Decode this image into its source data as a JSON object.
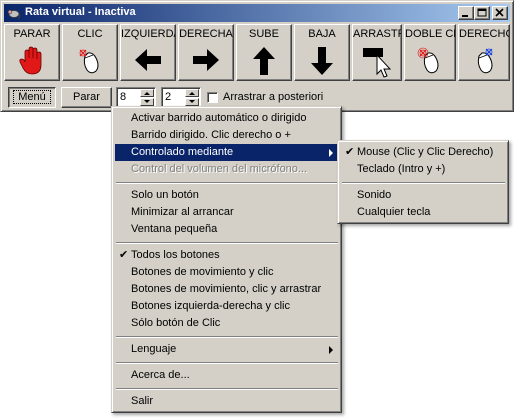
{
  "window": {
    "title": "Rata virtual - Inactiva",
    "controls": [
      "minimize-icon",
      "maximize-icon",
      "close-icon"
    ]
  },
  "toolbar": {
    "buttons": [
      {
        "label": "PARAR",
        "icon": "stop-hand-icon"
      },
      {
        "label": "CLIC",
        "icon": "mouse-click-icon"
      },
      {
        "label": "IZQUIERDA",
        "icon": "arrow-left-icon"
      },
      {
        "label": "DERECHA",
        "icon": "arrow-right-icon"
      },
      {
        "label": "SUBE",
        "icon": "arrow-up-icon"
      },
      {
        "label": "BAJA",
        "icon": "arrow-down-icon"
      },
      {
        "label": "ARRASTRAR",
        "icon": "drag-cursor-icon"
      },
      {
        "label": "DOBLE CLIC",
        "icon": "mouse-double-click-icon"
      },
      {
        "label": "DERECHO CLIC",
        "icon": "mouse-right-click-icon"
      }
    ]
  },
  "controls": {
    "menu_button": "Menú",
    "stop_button": "Parar",
    "speed_value": "8",
    "step_value": "2",
    "drag_later_label": "Arrastrar a posteriori",
    "drag_later_checked": false
  },
  "menu": {
    "items": [
      {
        "label": "Activar barrido automático o dirigido"
      },
      {
        "label": "Barrido dirigido. Clic derecho o +"
      },
      {
        "label": "Controlado mediante",
        "highlighted": true,
        "submenu": true
      },
      {
        "label": "Control del volumen del micrófono...",
        "disabled": true
      },
      {
        "label": "Solo un botón"
      },
      {
        "label": "Minimizar al arrancar"
      },
      {
        "label": "Ventana pequeña"
      },
      {
        "label": "Todos los botones",
        "checked": true
      },
      {
        "label": "Botones de movimiento y clic"
      },
      {
        "label": "Botones de movimiento, clic y arrastrar"
      },
      {
        "label": "Botones izquierda-derecha y clic"
      },
      {
        "label": "Sólo botón de Clic"
      },
      {
        "label": "Lenguaje",
        "submenu": true
      },
      {
        "label": "Acerca de..."
      },
      {
        "label": "Salir"
      }
    ]
  },
  "submenu": {
    "items": [
      {
        "label": "Mouse (Clic y Clic Derecho)",
        "checked": true
      },
      {
        "label": "Teclado (Intro y +)"
      },
      {
        "label": "Sonido"
      },
      {
        "label": "Cualquier tecla"
      }
    ]
  },
  "colors": {
    "face": "#d4d0c8",
    "title_start": "#0a246a",
    "title_end": "#a6caf0",
    "highlight": "#0a246a",
    "stop_red": "#e01818"
  }
}
